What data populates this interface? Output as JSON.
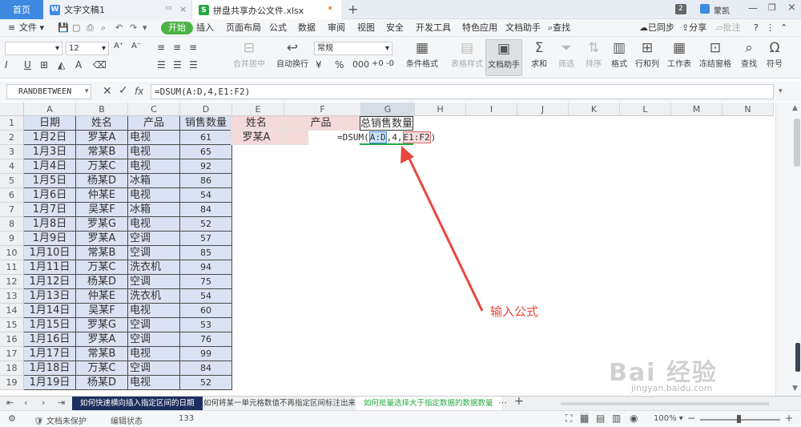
{
  "tabs": {
    "home": "首页",
    "doc": "文字文稿1",
    "sheet": "拼盘共享办公文件.xlsx",
    "new_tab": "+",
    "badge": "2",
    "user": "蒙凯"
  },
  "menu": {
    "file": "文件",
    "items": [
      "开始",
      "插入",
      "页面布局",
      "公式",
      "数据",
      "审阅",
      "视图",
      "安全",
      "开发工具",
      "特色应用",
      "文档助手"
    ],
    "search": "查找",
    "sync": "已同步",
    "share": "分享",
    "comment": "批注"
  },
  "ribbon": {
    "font_size": "12",
    "number_format": "常规",
    "merge_center": "合并居中",
    "wrap_text": "自动换行",
    "cond_format": "条件格式",
    "table_style": "表格样式",
    "doc_helper": "文档助手",
    "sum": "求和",
    "filter": "筛选",
    "sort": "排序",
    "format": "格式",
    "row_col": "行和列",
    "worksheet": "工作表",
    "freeze": "冻结窗格",
    "find": "查找",
    "symbol": "符号"
  },
  "formula_bar": {
    "name_box": "RANDBETWEEN",
    "fx": "fx",
    "formula": "=DSUM(A:D,4,E1:F2)"
  },
  "columns": [
    "A",
    "B",
    "C",
    "D",
    "E",
    "F",
    "G",
    "H",
    "I",
    "J",
    "K",
    "L",
    "M",
    "N"
  ],
  "headers": [
    "日期",
    "姓名",
    "产品",
    "销售数量"
  ],
  "rows": [
    [
      "1月2日",
      "罗某A",
      "电视",
      "61"
    ],
    [
      "1月3日",
      "常某B",
      "电视",
      "65"
    ],
    [
      "1月4日",
      "万某C",
      "电视",
      "92"
    ],
    [
      "1月5日",
      "杨某D",
      "冰箱",
      "86"
    ],
    [
      "1月6日",
      "仲某E",
      "电视",
      "54"
    ],
    [
      "1月7日",
      "吴某F",
      "冰箱",
      "84"
    ],
    [
      "1月8日",
      "罗某G",
      "电视",
      "52"
    ],
    [
      "1月9日",
      "罗某A",
      "空调",
      "57"
    ],
    [
      "1月10日",
      "常某B",
      "空调",
      "85"
    ],
    [
      "1月11日",
      "万某C",
      "洗衣机",
      "94"
    ],
    [
      "1月12日",
      "杨某D",
      "空调",
      "75"
    ],
    [
      "1月13日",
      "仲某E",
      "洗衣机",
      "54"
    ],
    [
      "1月14日",
      "吴某F",
      "电视",
      "60"
    ],
    [
      "1月15日",
      "罗某G",
      "空调",
      "53"
    ],
    [
      "1月16日",
      "罗某A",
      "空调",
      "76"
    ],
    [
      "1月17日",
      "常某B",
      "电视",
      "99"
    ],
    [
      "1月18日",
      "万某C",
      "空调",
      "84"
    ],
    [
      "1月19日",
      "杨某D",
      "电视",
      "52"
    ]
  ],
  "criteria": {
    "h_name": "姓名",
    "h_product": "产品",
    "h_total": "总销售数量",
    "name_value": "罗某A",
    "editing_prefix": "=DSUM(",
    "ref1": "A:D",
    "mid": ",4,",
    "ref2": "E1:F2",
    "suffix": ")"
  },
  "annotation": "输入公式",
  "sheet_tabs": [
    "如何快速横向插入指定区间的日期",
    "如何将某一单元格数值不再指定区间标注出来",
    "如何批量选择大于指定数据的数据数量"
  ],
  "status": {
    "protect": "文档未保护",
    "edit_state": "编辑状态",
    "count": "133",
    "zoom": "100%"
  },
  "watermark": {
    "brand": "Bai 经验",
    "url": "jingyan.baidu.com"
  },
  "colors": {
    "accent": "#3f8ae0",
    "start_green": "#4bb344",
    "data_fill": "#dae2f3",
    "criteria_fill": "#f4d9d9",
    "annotation_red": "#e8473f",
    "active_tab_green": "#27a844"
  }
}
